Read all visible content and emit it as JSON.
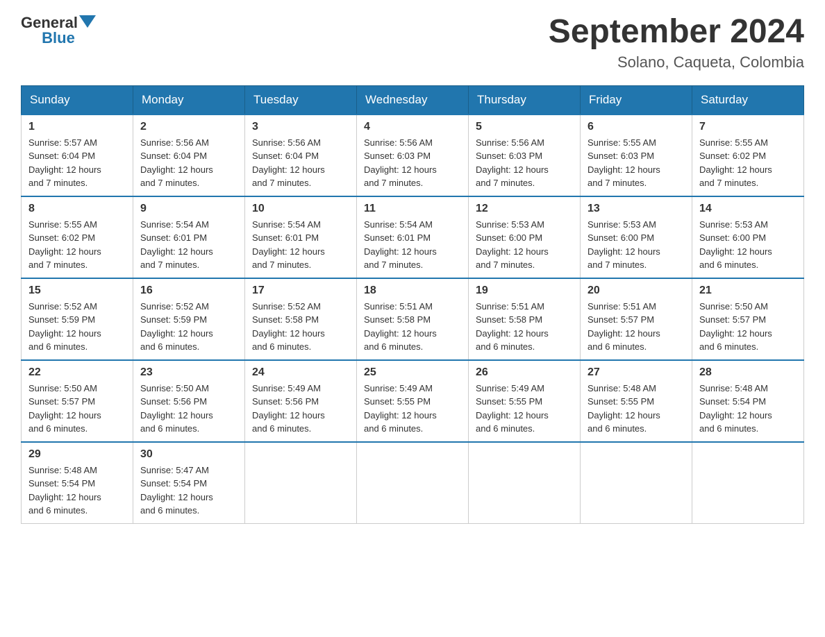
{
  "header": {
    "logo_general": "General",
    "logo_blue": "Blue",
    "title": "September 2024",
    "subtitle": "Solano, Caqueta, Colombia"
  },
  "days_of_week": [
    "Sunday",
    "Monday",
    "Tuesday",
    "Wednesday",
    "Thursday",
    "Friday",
    "Saturday"
  ],
  "weeks": [
    [
      {
        "day": "1",
        "sunrise": "5:57 AM",
        "sunset": "6:04 PM",
        "daylight": "12 hours and 7 minutes."
      },
      {
        "day": "2",
        "sunrise": "5:56 AM",
        "sunset": "6:04 PM",
        "daylight": "12 hours and 7 minutes."
      },
      {
        "day": "3",
        "sunrise": "5:56 AM",
        "sunset": "6:04 PM",
        "daylight": "12 hours and 7 minutes."
      },
      {
        "day": "4",
        "sunrise": "5:56 AM",
        "sunset": "6:03 PM",
        "daylight": "12 hours and 7 minutes."
      },
      {
        "day": "5",
        "sunrise": "5:56 AM",
        "sunset": "6:03 PM",
        "daylight": "12 hours and 7 minutes."
      },
      {
        "day": "6",
        "sunrise": "5:55 AM",
        "sunset": "6:03 PM",
        "daylight": "12 hours and 7 minutes."
      },
      {
        "day": "7",
        "sunrise": "5:55 AM",
        "sunset": "6:02 PM",
        "daylight": "12 hours and 7 minutes."
      }
    ],
    [
      {
        "day": "8",
        "sunrise": "5:55 AM",
        "sunset": "6:02 PM",
        "daylight": "12 hours and 7 minutes."
      },
      {
        "day": "9",
        "sunrise": "5:54 AM",
        "sunset": "6:01 PM",
        "daylight": "12 hours and 7 minutes."
      },
      {
        "day": "10",
        "sunrise": "5:54 AM",
        "sunset": "6:01 PM",
        "daylight": "12 hours and 7 minutes."
      },
      {
        "day": "11",
        "sunrise": "5:54 AM",
        "sunset": "6:01 PM",
        "daylight": "12 hours and 7 minutes."
      },
      {
        "day": "12",
        "sunrise": "5:53 AM",
        "sunset": "6:00 PM",
        "daylight": "12 hours and 7 minutes."
      },
      {
        "day": "13",
        "sunrise": "5:53 AM",
        "sunset": "6:00 PM",
        "daylight": "12 hours and 7 minutes."
      },
      {
        "day": "14",
        "sunrise": "5:53 AM",
        "sunset": "6:00 PM",
        "daylight": "12 hours and 6 minutes."
      }
    ],
    [
      {
        "day": "15",
        "sunrise": "5:52 AM",
        "sunset": "5:59 PM",
        "daylight": "12 hours and 6 minutes."
      },
      {
        "day": "16",
        "sunrise": "5:52 AM",
        "sunset": "5:59 PM",
        "daylight": "12 hours and 6 minutes."
      },
      {
        "day": "17",
        "sunrise": "5:52 AM",
        "sunset": "5:58 PM",
        "daylight": "12 hours and 6 minutes."
      },
      {
        "day": "18",
        "sunrise": "5:51 AM",
        "sunset": "5:58 PM",
        "daylight": "12 hours and 6 minutes."
      },
      {
        "day": "19",
        "sunrise": "5:51 AM",
        "sunset": "5:58 PM",
        "daylight": "12 hours and 6 minutes."
      },
      {
        "day": "20",
        "sunrise": "5:51 AM",
        "sunset": "5:57 PM",
        "daylight": "12 hours and 6 minutes."
      },
      {
        "day": "21",
        "sunrise": "5:50 AM",
        "sunset": "5:57 PM",
        "daylight": "12 hours and 6 minutes."
      }
    ],
    [
      {
        "day": "22",
        "sunrise": "5:50 AM",
        "sunset": "5:57 PM",
        "daylight": "12 hours and 6 minutes."
      },
      {
        "day": "23",
        "sunrise": "5:50 AM",
        "sunset": "5:56 PM",
        "daylight": "12 hours and 6 minutes."
      },
      {
        "day": "24",
        "sunrise": "5:49 AM",
        "sunset": "5:56 PM",
        "daylight": "12 hours and 6 minutes."
      },
      {
        "day": "25",
        "sunrise": "5:49 AM",
        "sunset": "5:55 PM",
        "daylight": "12 hours and 6 minutes."
      },
      {
        "day": "26",
        "sunrise": "5:49 AM",
        "sunset": "5:55 PM",
        "daylight": "12 hours and 6 minutes."
      },
      {
        "day": "27",
        "sunrise": "5:48 AM",
        "sunset": "5:55 PM",
        "daylight": "12 hours and 6 minutes."
      },
      {
        "day": "28",
        "sunrise": "5:48 AM",
        "sunset": "5:54 PM",
        "daylight": "12 hours and 6 minutes."
      }
    ],
    [
      {
        "day": "29",
        "sunrise": "5:48 AM",
        "sunset": "5:54 PM",
        "daylight": "12 hours and 6 minutes."
      },
      {
        "day": "30",
        "sunrise": "5:47 AM",
        "sunset": "5:54 PM",
        "daylight": "12 hours and 6 minutes."
      },
      null,
      null,
      null,
      null,
      null
    ]
  ],
  "labels": {
    "sunrise_prefix": "Sunrise: ",
    "sunset_prefix": "Sunset: ",
    "daylight_prefix": "Daylight: "
  }
}
